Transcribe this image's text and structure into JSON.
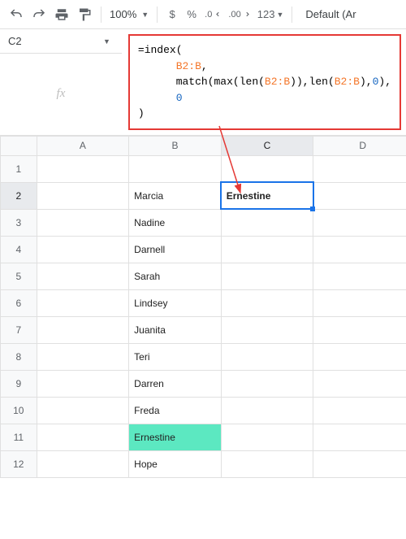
{
  "toolbar": {
    "zoom": "100%",
    "fmt_currency": "$",
    "fmt_percent": "%",
    "fmt_dec_dec": ".0",
    "fmt_dec_inc": ".00",
    "fmt_123": "123",
    "font_name": "Default (Ar"
  },
  "namebox": {
    "cell_ref": "C2",
    "fx_label": "fx"
  },
  "formula": {
    "l1_a": "=index(",
    "l2_ref": "B2:B",
    "l2_b": ",",
    "l3_a": "match(max(len(",
    "l3_ref1": "B2:B",
    "l3_b": ")),len(",
    "l3_ref2": "B2:B",
    "l3_c": "),",
    "l3_num": "0",
    "l3_d": "),",
    "l4_num": "0",
    "l5_a": ")"
  },
  "columns": [
    "A",
    "B",
    "C",
    "D"
  ],
  "rows": [
    {
      "n": 1,
      "B": "",
      "C": ""
    },
    {
      "n": 2,
      "B": "Marcia",
      "C": "Ernestine"
    },
    {
      "n": 3,
      "B": "Nadine",
      "C": ""
    },
    {
      "n": 4,
      "B": "Darnell",
      "C": ""
    },
    {
      "n": 5,
      "B": "Sarah",
      "C": ""
    },
    {
      "n": 6,
      "B": "Lindsey",
      "C": ""
    },
    {
      "n": 7,
      "B": "Juanita",
      "C": ""
    },
    {
      "n": 8,
      "B": "Teri",
      "C": ""
    },
    {
      "n": 9,
      "B": "Darren",
      "C": ""
    },
    {
      "n": 10,
      "B": "Freda",
      "C": ""
    },
    {
      "n": 11,
      "B": "Ernestine",
      "C": ""
    },
    {
      "n": 12,
      "B": "Hope",
      "C": ""
    }
  ],
  "highlight_row": 11,
  "selected_cell": {
    "row": 2,
    "col": "C"
  }
}
